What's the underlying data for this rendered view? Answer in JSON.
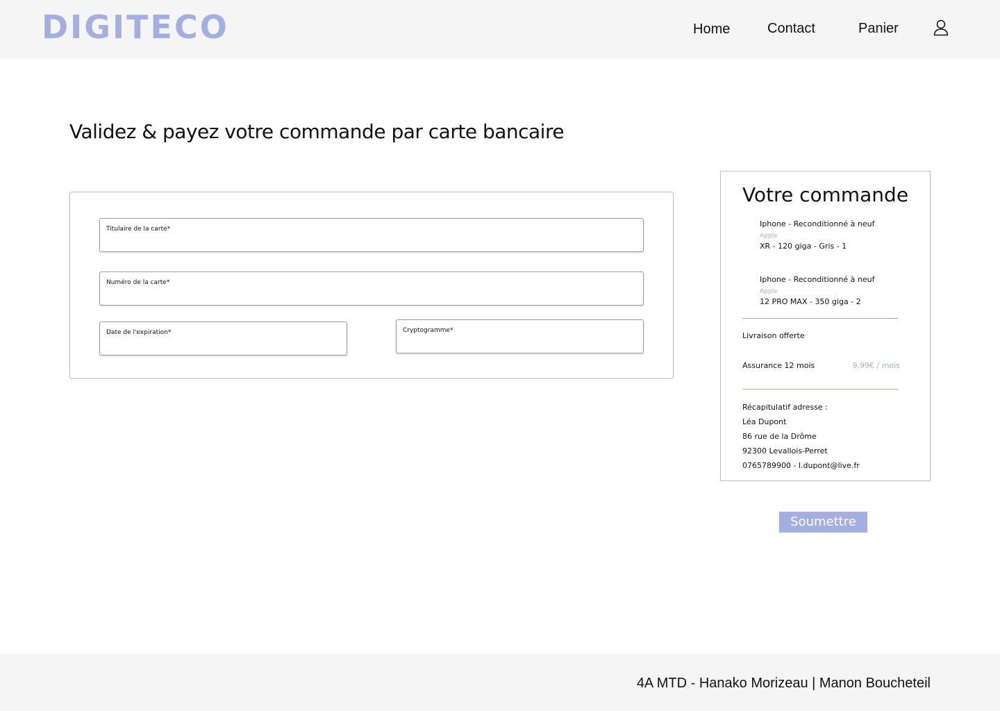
{
  "header": {
    "logo": "DIGITECO",
    "nav": {
      "home": "Home",
      "contact": "Contact",
      "cart": "Panier"
    },
    "user_icon": "user-icon"
  },
  "main": {
    "title": "Validez & payez votre commande par carte bancaire",
    "form": {
      "holder_label": "Titulaire de la carte*",
      "number_label": "Numéro de la carte*",
      "expiry_label": "Date de l'expiration*",
      "cvv_label": "Cryptogramme*",
      "holder_value": "",
      "number_value": "",
      "expiry_value": "",
      "cvv_value": ""
    }
  },
  "order": {
    "title": "Votre commande",
    "items": [
      {
        "name": "Iphone -  Reconditionné à neuf",
        "brand": "Apple",
        "details": "XR - 120 giga - Gris - 1"
      },
      {
        "name": "Iphone -  Reconditionné à neuf",
        "brand": "Apple",
        "details": "12  PRO  MAX - 350 giga - 2"
      }
    ],
    "delivery": "Livraison offerte",
    "insurance_label": "Assurance 12 mois",
    "insurance_price": "9,99€ / mois",
    "address": {
      "heading": "Récapitulatif adresse :",
      "name": "Léa  Dupont",
      "street": "86 rue de la  Drôme",
      "city": "92300  Levallois-Perret",
      "contact": "0765789900 - l.dupont@live.fr"
    }
  },
  "submit_label": "Soumettre",
  "footer": {
    "credits": "4A MTD - Hanako Morizeau | Manon Boucheteil"
  },
  "colors": {
    "accent": "#a5aee0",
    "band": "#f5f5f5"
  }
}
